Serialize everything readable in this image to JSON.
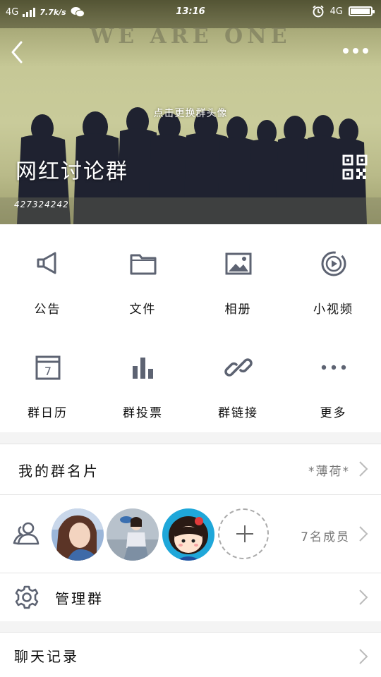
{
  "status_bar": {
    "network": "4G",
    "speed": "7.7k/s",
    "time": "13:16",
    "network_right": "4G",
    "battery_level": 0.95
  },
  "header": {
    "motto": "WE ARE ONE",
    "change_avatar_hint": "点击更换群头像",
    "group_name": "网红讨论群",
    "group_id": "427324242"
  },
  "features": [
    {
      "label": "公告",
      "icon": "megaphone-icon"
    },
    {
      "label": "文件",
      "icon": "folder-icon"
    },
    {
      "label": "相册",
      "icon": "photo-album-icon"
    },
    {
      "label": "小视频",
      "icon": "video-icon"
    },
    {
      "label": "群日历",
      "icon": "calendar-icon"
    },
    {
      "label": "群投票",
      "icon": "bar-chart-icon"
    },
    {
      "label": "群链接",
      "icon": "link-icon"
    },
    {
      "label": "更多",
      "icon": "more-dots-icon"
    }
  ],
  "calendar_day": "7",
  "my_card": {
    "label": "我的群名片",
    "value": "*薄荷*"
  },
  "members": {
    "count_label": "7名成员"
  },
  "manage": {
    "label": "管理群"
  },
  "chat_history": {
    "label": "聊天记录"
  },
  "colors": {
    "accent_icon": "#5d6372",
    "divider": "#e3e3e3",
    "page_bg": "#f4f4f4"
  }
}
